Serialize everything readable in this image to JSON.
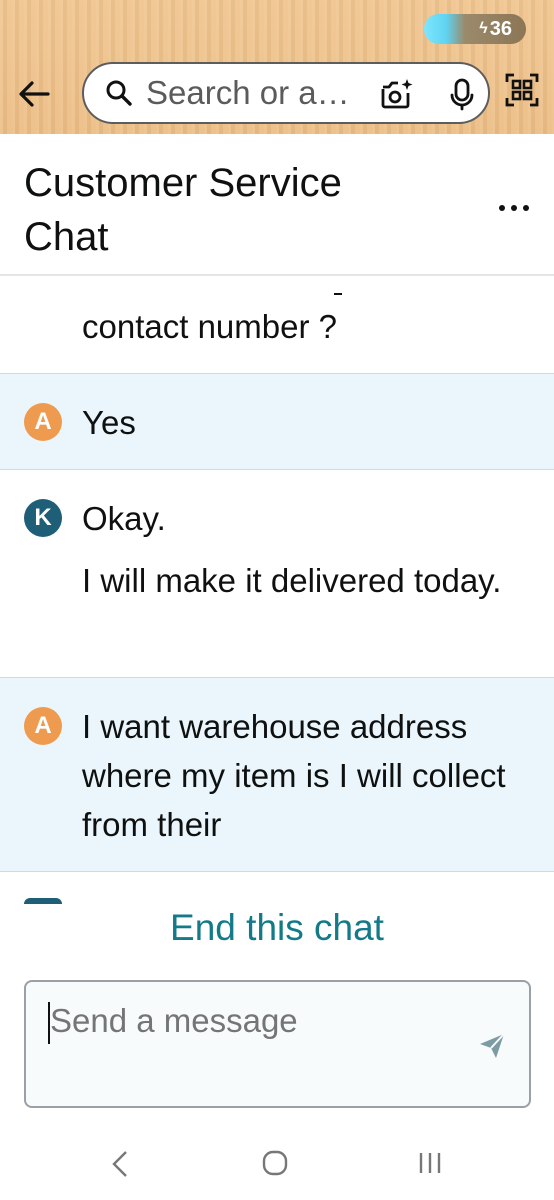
{
  "status_bar": {
    "battery_level": "36",
    "battery_accent": "#5fd3f0"
  },
  "header": {
    "search_placeholder": "Search or a…",
    "background_color": "#ecbd84"
  },
  "title_bar": {
    "title": "Customer Service Chat"
  },
  "messages": [
    {
      "sender_initial": "",
      "lines": [
        "contact number ?"
      ],
      "role": "agent"
    },
    {
      "sender_initial": "A",
      "lines": [
        "Yes"
      ],
      "role": "customer"
    },
    {
      "sender_initial": "K",
      "lines": [
        "Okay.",
        "I will make it delivered today."
      ],
      "role": "agent"
    },
    {
      "sender_initial": "A",
      "lines": [
        "I want warehouse address where my item is I will collect from their"
      ],
      "role": "customer"
    }
  ],
  "end_chat_label": "End this chat",
  "composer": {
    "placeholder": "Send a message"
  },
  "colors": {
    "customer_bubble": "#eaf6fb",
    "agent_avatar": "#1e5e77",
    "customer_avatar": "#ee9a4f",
    "link": "#137a8a"
  }
}
